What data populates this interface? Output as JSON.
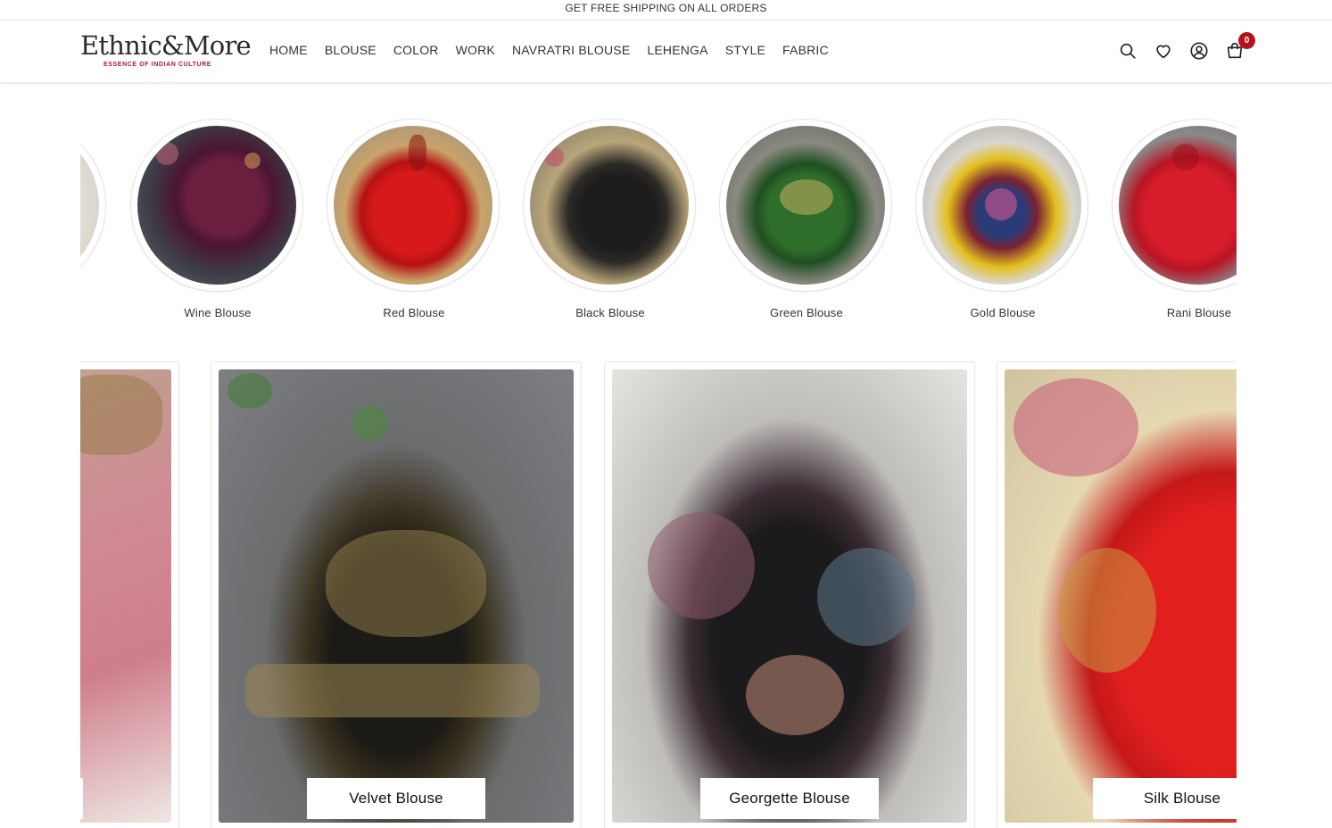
{
  "announcement": {
    "text": "GET FREE SHIPPING ON ALL ORDERS"
  },
  "brand": {
    "name": "Ethnic&More",
    "tagline": "ESSENCE OF INDIAN CULTURE",
    "accent": "#b5172a"
  },
  "nav": {
    "items": [
      {
        "label": "HOME"
      },
      {
        "label": "BLOUSE"
      },
      {
        "label": "COLOR"
      },
      {
        "label": "WORK"
      },
      {
        "label": "NAVRATRI BLOUSE"
      },
      {
        "label": "LEHENGA"
      },
      {
        "label": "STYLE"
      },
      {
        "label": "FABRIC"
      }
    ]
  },
  "header_icons": [
    {
      "name": "search-icon"
    },
    {
      "name": "heart-icon"
    },
    {
      "name": "user-icon"
    },
    {
      "name": "cart-icon"
    }
  ],
  "cart": {
    "count": "0",
    "badge_color": "#b5121b"
  },
  "color_categories": {
    "items": [
      {
        "label": "Wine Blouse"
      },
      {
        "label": "Red Blouse"
      },
      {
        "label": "Black Blouse"
      },
      {
        "label": "Green Blouse"
      },
      {
        "label": "Gold Blouse"
      },
      {
        "label": "Rani Blouse"
      }
    ]
  },
  "fabric_categories": {
    "items": [
      {
        "label": "Velvet Blouse"
      },
      {
        "label": "Georgette Blouse"
      },
      {
        "label": "Silk Blouse"
      }
    ]
  }
}
